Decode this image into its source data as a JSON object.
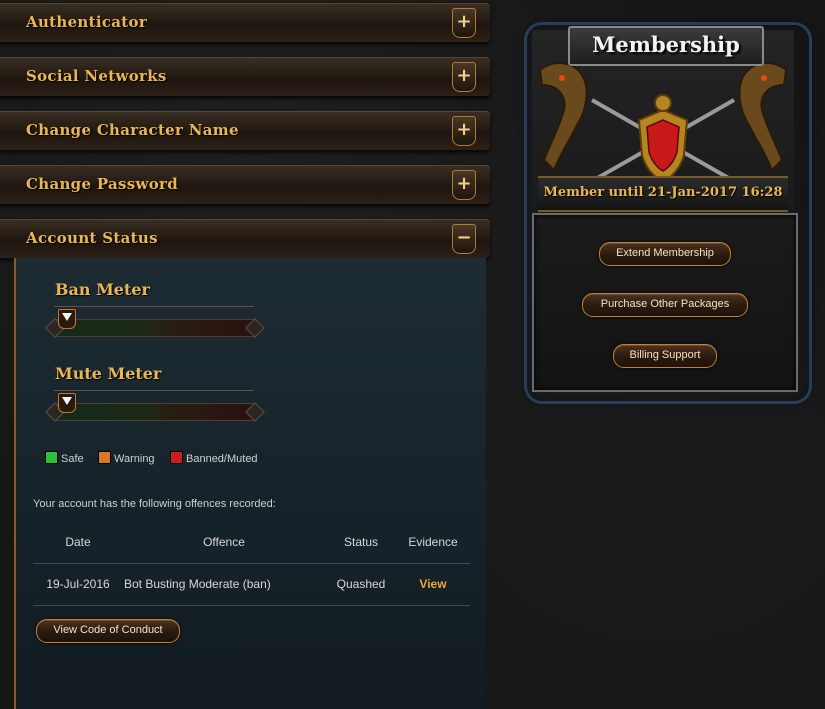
{
  "accordion": [
    {
      "title": "Authenticator",
      "toggle": "+"
    },
    {
      "title": "Social Networks",
      "toggle": "+"
    },
    {
      "title": "Change Character Name",
      "toggle": "+"
    },
    {
      "title": "Change Password",
      "toggle": "+"
    },
    {
      "title": "Account Status",
      "toggle": "−"
    }
  ],
  "account_status": {
    "ban_meter": {
      "title": "Ban Meter",
      "level_fraction": 0.0
    },
    "mute_meter": {
      "title": "Mute Meter",
      "level_fraction": 0.0
    },
    "legend": [
      {
        "label": "Safe",
        "color": "#2fbf3a"
      },
      {
        "label": "Warning",
        "color": "#d97a22"
      },
      {
        "label": "Banned/Muted",
        "color": "#c81e1e"
      }
    ],
    "offences_text": "Your account has the following offences recorded:",
    "table": {
      "headers": [
        "Date",
        "Offence",
        "Status",
        "Evidence"
      ],
      "rows": [
        {
          "date": "19-Jul-2016",
          "offence": "Bot Busting Moderate (ban)",
          "status": "Quashed",
          "evidence": "View"
        }
      ]
    },
    "conduct_button": "View Code of Conduct"
  },
  "membership": {
    "title": "Membership",
    "until": "Member until 21-Jan-2017 16:28",
    "buttons": [
      "Extend Membership",
      "Purchase Other Packages",
      "Billing Support"
    ]
  }
}
